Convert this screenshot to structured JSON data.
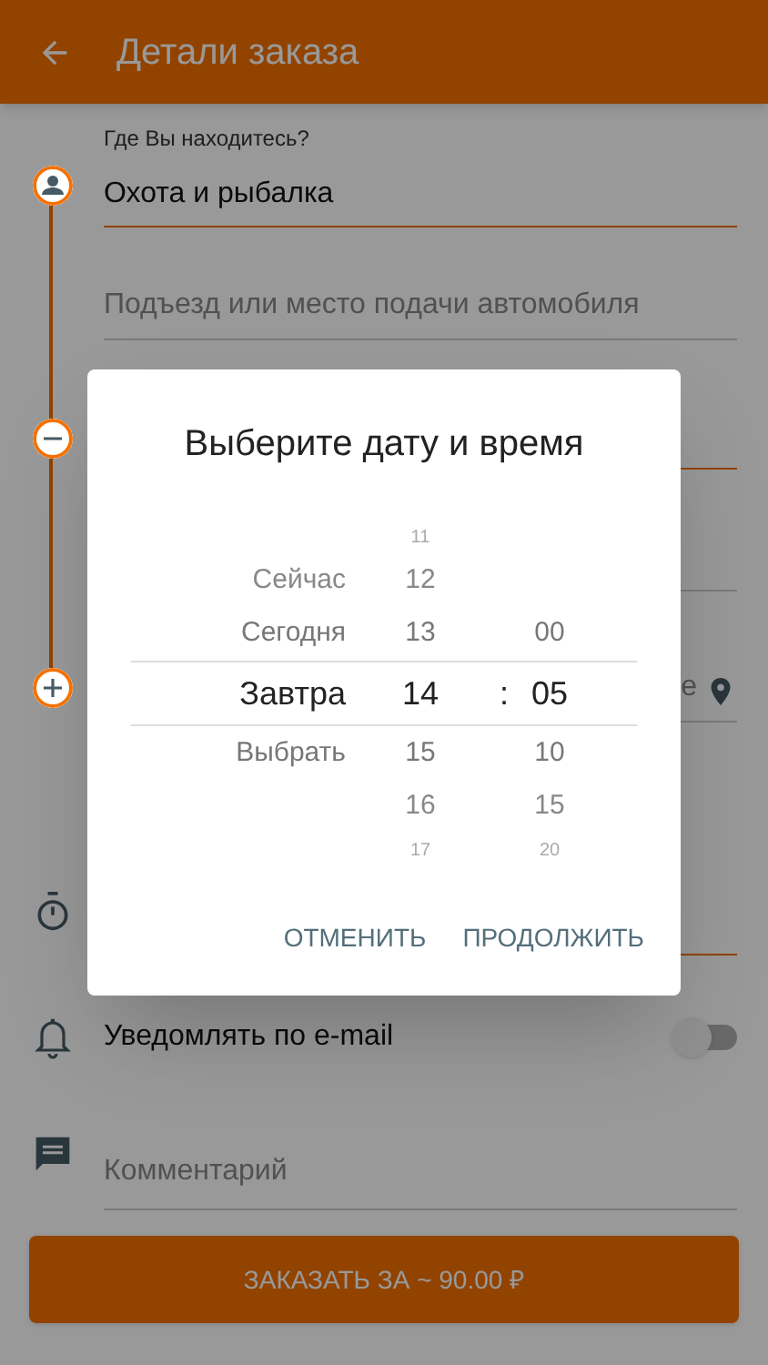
{
  "app_bar": {
    "title": "Детали заказа"
  },
  "form": {
    "location": {
      "label": "Где Вы находитесь?",
      "value": "Охота и рыбалка"
    },
    "entrance": {
      "placeholder": "Подъезд или место подачи автомобиля"
    },
    "destination": {
      "value": "е"
    },
    "notify": {
      "label": "Уведомлять по e-mail",
      "on": false
    },
    "comment": {
      "placeholder": "Комментарий"
    },
    "order_button": "ЗАКАЗАТЬ ЗА ~ 90.00 ₽"
  },
  "dialog": {
    "title": "Выберите дату и время",
    "separator": ":",
    "rows": [
      {
        "hour": "11",
        "selected": false
      },
      {
        "day": "Сейчас",
        "hour": "12",
        "selected": false
      },
      {
        "day": "Сегодня",
        "hour": "13",
        "minute": "00",
        "selected": false
      },
      {
        "day": "Завтра",
        "hour": "14",
        "minute": "05",
        "selected": true
      },
      {
        "day": "Выбрать",
        "hour": "15",
        "minute": "10",
        "selected": false
      },
      {
        "hour": "16",
        "minute": "15",
        "selected": false
      },
      {
        "hour": "17",
        "minute": "20",
        "selected": false
      }
    ],
    "buttons": [
      "ОТМЕНИТЬ",
      "ПРОДОЛЖИТЬ"
    ]
  }
}
